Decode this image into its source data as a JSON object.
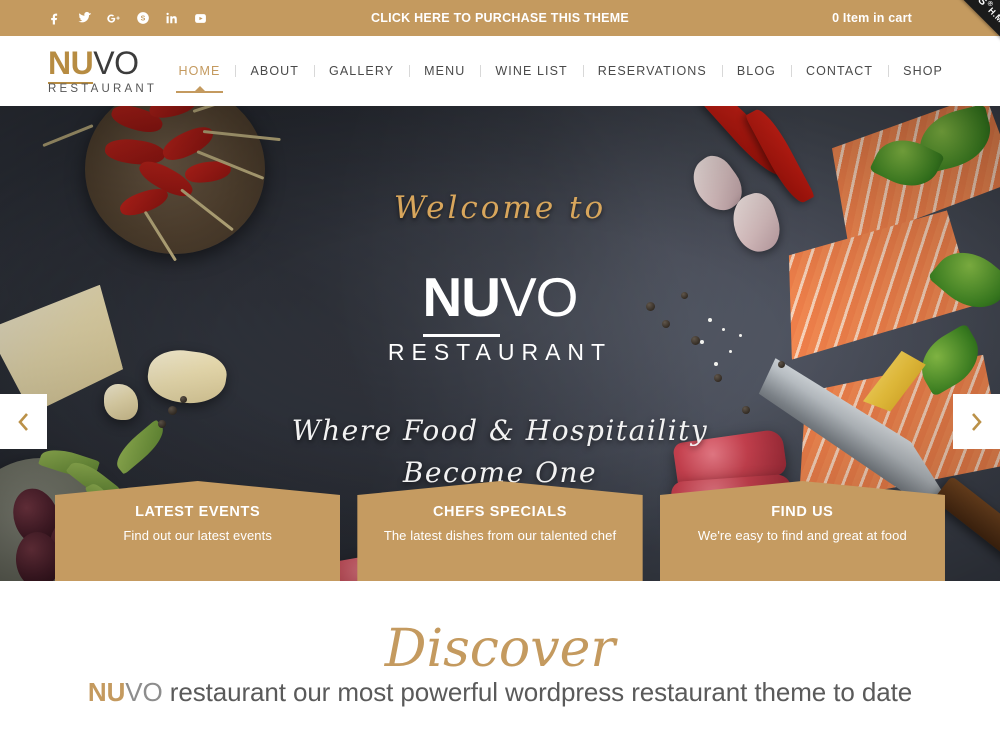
{
  "topbar": {
    "social": [
      {
        "name": "facebook-icon",
        "label": "Facebook"
      },
      {
        "name": "twitter-icon",
        "label": "Twitter"
      },
      {
        "name": "google-plus-icon",
        "label": "Google Plus"
      },
      {
        "name": "skype-icon",
        "label": "Skype"
      },
      {
        "name": "linkedin-icon",
        "label": "LinkedIn"
      },
      {
        "name": "youtube-icon",
        "label": "YouTube"
      }
    ],
    "purchase_text": "CLICK HERE TO PURCHASE THIS THEME",
    "cart_text": "0 Item in cart",
    "ribbon": {
      "pre": "AW",
      "mid": "WW",
      "post": "ARDS",
      "reg": "®",
      "hm": "H.M"
    },
    "bg_color": "#c49a5f"
  },
  "header": {
    "logo": {
      "nu": "NU",
      "vo": "VO",
      "sub": "RESTAURANT"
    },
    "nav": [
      {
        "label": "HOME",
        "active": true
      },
      {
        "label": "ABOUT",
        "active": false
      },
      {
        "label": "GALLERY",
        "active": false
      },
      {
        "label": "MENU",
        "active": false
      },
      {
        "label": "WINE LIST",
        "active": false
      },
      {
        "label": "RESERVATIONS",
        "active": false
      },
      {
        "label": "BLOG",
        "active": false
      },
      {
        "label": "CONTACT",
        "active": false
      },
      {
        "label": "SHOP",
        "active": false
      }
    ],
    "accent_color": "#c49a5f"
  },
  "hero": {
    "welcome": "Welcome to",
    "logo": {
      "nu": "NU",
      "vo": "VO",
      "sub": "RESTAURANT"
    },
    "tagline_line1": "Where Food & Hospitaility",
    "tagline_line2": "Become One",
    "prev_arrow": "‹",
    "next_arrow": "›",
    "background_description": "Dark slate board with dried red chilies in a bowl, parmesan wedges, black olives, red pepper dip, salmon fillets, red chili peppers, parsley, lemon wedge, garlic cloves, raw steak, roast beef, chef knife and peppercorns",
    "slate_color": "#454a57"
  },
  "promos": [
    {
      "title": "LATEST EVENTS",
      "subtitle": "Find out our latest events"
    },
    {
      "title": "CHEFS SPECIALS",
      "subtitle": "The latest dishes from our talented chef"
    },
    {
      "title": "FIND US",
      "subtitle": "We're easy to find and great at food"
    }
  ],
  "discover": {
    "script": "Discover",
    "nu": "NU",
    "vo": "VO",
    "text": " restaurant our most powerful wordpress restaurant theme to date"
  }
}
